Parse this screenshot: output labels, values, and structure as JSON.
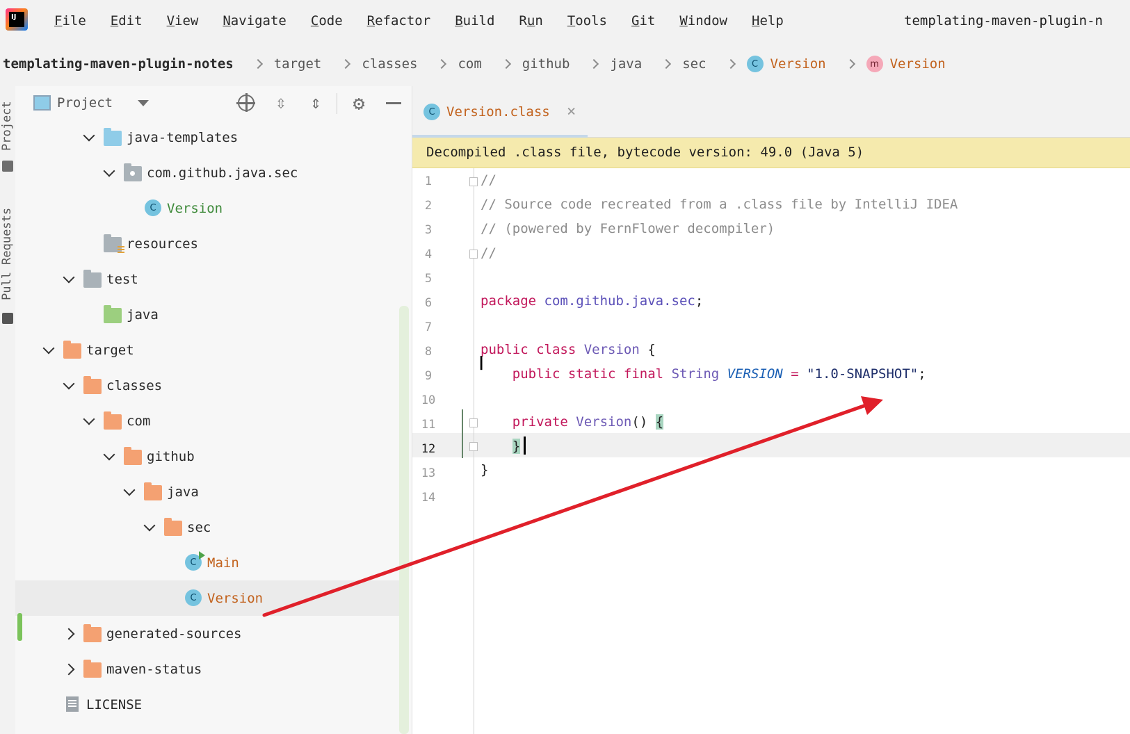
{
  "app": {
    "logo_text": "IJ",
    "window_title": "templating-maven-plugin-n"
  },
  "menu": [
    {
      "mnemonic": "F",
      "rest": "ile"
    },
    {
      "mnemonic": "E",
      "rest": "dit"
    },
    {
      "mnemonic": "V",
      "rest": "iew"
    },
    {
      "mnemonic": "N",
      "rest": "avigate"
    },
    {
      "mnemonic": "C",
      "rest": "ode"
    },
    {
      "mnemonic": "R",
      "rest": "efactor"
    },
    {
      "mnemonic": "B",
      "rest": "uild"
    },
    {
      "pre": "R",
      "mnemonic": "u",
      "rest": "n"
    },
    {
      "mnemonic": "T",
      "rest": "ools"
    },
    {
      "mnemonic": "G",
      "rest": "it"
    },
    {
      "mnemonic": "W",
      "rest": "indow"
    },
    {
      "mnemonic": "H",
      "rest": "elp"
    }
  ],
  "breadcrumb": {
    "root": "templating-maven-plugin-notes",
    "items": [
      "target",
      "classes",
      "com",
      "github",
      "java",
      "sec"
    ],
    "class_icon": "C",
    "class_label": "Version",
    "method_icon": "m",
    "method_label": "Version"
  },
  "tool_strip": {
    "project_tab": "Project",
    "pull_requests_tab": "Pull Requests"
  },
  "project_panel": {
    "title": "Project",
    "icons": [
      "locate-icon",
      "expand-all-icon",
      "collapse-all-icon",
      "gear-icon",
      "hide-icon"
    ],
    "tree": [
      {
        "label": "java-templates",
        "icon": "folder-blue",
        "expanded": true
      },
      {
        "label": "com.github.java.sec",
        "icon": "package-folder",
        "expanded": true
      },
      {
        "label": "Version",
        "icon": "class",
        "color": "green"
      },
      {
        "label": "resources",
        "icon": "resources-folder"
      },
      {
        "label": "test",
        "icon": "folder-gray",
        "expanded": true
      },
      {
        "label": "java",
        "icon": "folder-green"
      },
      {
        "label": "target",
        "icon": "folder-orange",
        "expanded": true
      },
      {
        "label": "classes",
        "icon": "folder-orange",
        "expanded": true
      },
      {
        "label": "com",
        "icon": "folder-orange",
        "expanded": true
      },
      {
        "label": "github",
        "icon": "folder-orange",
        "expanded": true
      },
      {
        "label": "java",
        "icon": "folder-orange",
        "expanded": true
      },
      {
        "label": "sec",
        "icon": "folder-orange",
        "expanded": true
      },
      {
        "label": "Main",
        "icon": "class-runnable",
        "color": "orange"
      },
      {
        "label": "Version",
        "icon": "class",
        "color": "orange",
        "selected": true
      },
      {
        "label": "generated-sources",
        "icon": "folder-orange",
        "expanded": false
      },
      {
        "label": "maven-status",
        "icon": "folder-orange",
        "expanded": false
      },
      {
        "label": "LICENSE",
        "icon": "file"
      }
    ]
  },
  "editor": {
    "tab_label": "Version.class",
    "tab_icon": "C",
    "tab_close": "×",
    "banner": "Decompiled .class file, bytecode version: 49.0 (Java 5)",
    "line_numbers": [
      "1",
      "2",
      "3",
      "4",
      "5",
      "6",
      "7",
      "8",
      "9",
      "10",
      "11",
      "12",
      "13",
      "14"
    ],
    "current_line": "12",
    "code": {
      "l1": "//",
      "l2": "// Source code recreated from a .class file by IntelliJ IDEA",
      "l3": "// (powered by FernFlower decompiler)",
      "l4": "//",
      "l6_kw": "package",
      "l6_pkg": "com.github.java.sec",
      "l6_end": ";",
      "l8_kw": "public class",
      "l8_type": "Version",
      "l8_end": "{",
      "l9_kw": "public static final",
      "l9_type": "String",
      "l9_const": "VERSION",
      "l9_op": "=",
      "l9_str": "\"1.0-SNAPSHOT\"",
      "l9_end": ";",
      "l11_kw": "private",
      "l11_name": "Version",
      "l11_paren": "()",
      "l11_brace": "{",
      "l12_brace": "}",
      "l13": "}"
    }
  },
  "annotation": {
    "arrow_color": "#e0202a"
  }
}
